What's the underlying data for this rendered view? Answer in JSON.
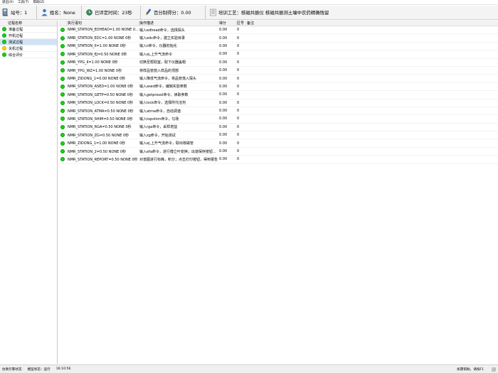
{
  "menu": {
    "items": [
      "退出(X)",
      "工具(T)",
      "帮助(Z)"
    ]
  },
  "info": {
    "station": "站号：1",
    "name": "姓名：None",
    "elapsed": "已评定时间：23秒",
    "score": "百分制得分：0.00",
    "process": "培训工艺：核磁共振仪  核磁共振测土壤中农药精确残留"
  },
  "sidebar": {
    "header": "过程名称",
    "items": [
      {
        "label": "准备过程",
        "status": "green"
      },
      {
        "label": "开机过程",
        "status": "green"
      },
      {
        "label": "测试过程",
        "status": "green",
        "selected": true
      },
      {
        "label": "关机过程",
        "status": "yellow"
      },
      {
        "label": "综合评价",
        "status": "green"
      }
    ]
  },
  "table": {
    "headers": [
      "执行语句",
      "操作描述",
      "得分",
      "区号",
      "备注"
    ],
    "rows": [
      {
        "stmt": "NMR_STATION_EDHEAD=1.00  NONE  0...",
        "desc": "输入edhead命令，选择探头",
        "score": "0.00",
        "zone": "0"
      },
      {
        "stmt": "NMR_STATION_EDC=1.00  NONE  0秒",
        "desc": "输入edc命令，建立实验目录",
        "score": "0.00",
        "zone": "0"
      },
      {
        "stmt": "NMR_STATION_II=1.00  NONE  0秒",
        "desc": "输入ii命令，仪器初始化",
        "score": "0.00",
        "zone": "0"
      },
      {
        "stmt": "NMR_STATION_EJ=0.50  NONE  0秒",
        "desc": "输入ej,上升气流命令",
        "score": "0.00",
        "zone": "0"
      },
      {
        "stmt": "NMR_YPG_II=1.00  NONE  0秒",
        "desc": "切换至帮助室，取下仪器盖帽",
        "score": "0.00",
        "zone": "0"
      },
      {
        "stmt": "NMR_YPG_WZ=1.00  NONE  0秒",
        "desc": "将样品管放入样品的顶部",
        "score": "0.00",
        "zone": "0"
      },
      {
        "stmt": "NMR_ZIDONG_1=0.00  NONE  0秒",
        "desc": "输入降低气流命令，将品管落入探头",
        "score": "0.00",
        "zone": "0"
      },
      {
        "stmt": "NMR_STATION_ASED=1.00  NONE  0秒",
        "desc": "输入ased命令，编辑实验参数",
        "score": "0.00",
        "zone": "0"
      },
      {
        "stmt": "NMR_STATION_GETP=0.50  NONE  0秒",
        "desc": "输入getprosol命令，读取参数",
        "score": "0.00",
        "zone": "0"
      },
      {
        "stmt": "NMR_STATION_LOCK=0.50  NONE  0秒",
        "desc": "输入lock命令，选择所代溶剂",
        "score": "0.00",
        "zone": "0"
      },
      {
        "stmt": "NMR_STATION_ATMA=0.50  NONE  0秒",
        "desc": "输入atma命令，自动调谐",
        "score": "0.00",
        "zone": "0"
      },
      {
        "stmt": "NMR_STATION_SHIM=0.50  NONE  0秒",
        "desc": "输入topshim命令，匀场",
        "score": "0.00",
        "zone": "0"
      },
      {
        "stmt": "NMR_STATION_RGA=0.50  NONE  0秒",
        "desc": "输入rga命令，采样增益",
        "score": "0.00",
        "zone": "0"
      },
      {
        "stmt": "NMR_STATION_ZG=0.50  NONE  0秒",
        "desc": "输入zg命令，开始测试",
        "score": "0.00",
        "zone": "0"
      },
      {
        "stmt": "NMR_ZIDONG_1=1.00  NONE  0秒",
        "desc": "输入ej,上升气流命令，取出核磁管",
        "score": "0.00",
        "zone": "0"
      },
      {
        "stmt": "NMR_STATION_2=0.50  NONE  0秒",
        "desc": "输入efa命令，进行傅立叶变换；出谱保存按钮...",
        "score": "0.00",
        "zone": "0"
      },
      {
        "stmt": "NMR_STATION_REPORT=0.50  NONE  0秒",
        "desc": "对谱图进行标峰，积分；点击打印按钮，得到报告",
        "score": "0.00",
        "zone": "0"
      }
    ]
  },
  "statusbar": {
    "left1": "仿真引擎状态",
    "left2": "模型状态：运行",
    "time": "16:10:56",
    "right": "如需帮助，请按F1"
  },
  "colors": {
    "green": "#19d319",
    "yellow": "#ffd800",
    "selected": "#cfe3f7"
  }
}
